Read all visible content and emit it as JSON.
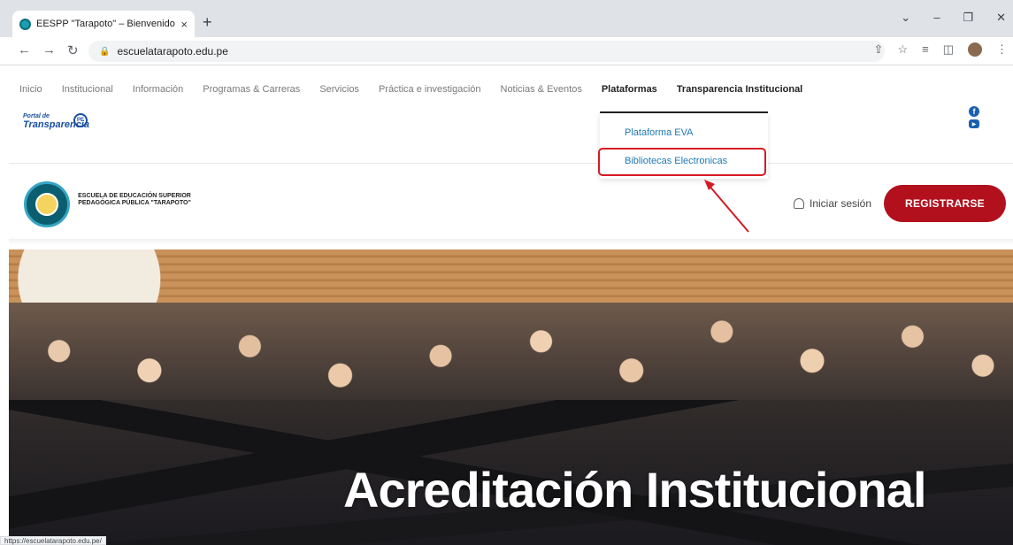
{
  "browser": {
    "tab_title": "EESPP \"Tarapoto\" – Bienvenido, a",
    "tab_close": "×",
    "new_tab": "+",
    "url": "escuelatarapoto.edu.pe",
    "status_url": "https://escuelatarapoto.edu.pe/"
  },
  "nav": {
    "items": [
      {
        "label": "Inicio"
      },
      {
        "label": "Institucional"
      },
      {
        "label": "Información"
      },
      {
        "label": "Programas & Carreras"
      },
      {
        "label": "Servicios"
      },
      {
        "label": "Práctica e investigación"
      },
      {
        "label": "Noticias & Eventos"
      },
      {
        "label": "Plataformas"
      },
      {
        "label": "Transparencia Institucional"
      }
    ]
  },
  "transparencia": {
    "line1": "Portal de",
    "line2": "Transparencia",
    "badge": "PE"
  },
  "dropdown": {
    "items": [
      {
        "label": "Plataforma EVA"
      },
      {
        "label": "Bibliotecas Electronicas"
      }
    ]
  },
  "school": {
    "name": "ESCUELA DE EDUCACIÓN SUPERIOR PEDAGÓGICA PÚBLICA \"TARAPOTO\""
  },
  "header": {
    "login_label": "Iniciar sesión",
    "register_label": "REGISTRARSE"
  },
  "hero": {
    "title": "Acreditación Institucional"
  },
  "colors": {
    "brand_red": "#b3101d",
    "link_blue": "#1e78b4",
    "highlight_red": "#d51b24"
  }
}
